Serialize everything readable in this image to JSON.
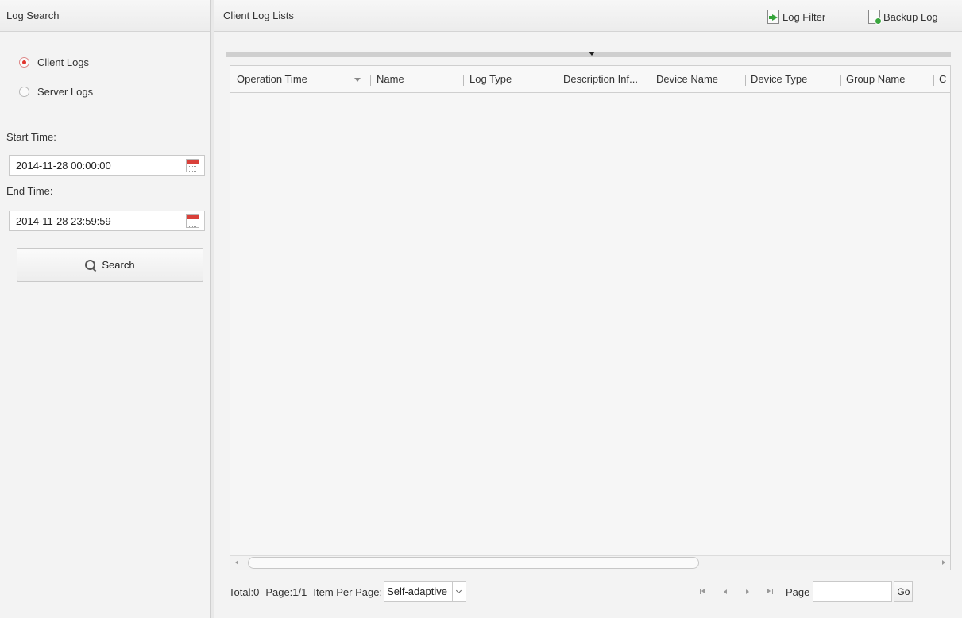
{
  "left": {
    "header_title": "Log Search",
    "radios": [
      {
        "label": "Client Logs",
        "checked": true
      },
      {
        "label": "Server Logs",
        "checked": false
      }
    ],
    "start_label": "Start Time:",
    "start_value": "2014-11-28 00:00:00",
    "end_label": "End Time:",
    "end_value": "2014-11-28 23:59:59",
    "search_label": "Search"
  },
  "right": {
    "title": "Client Log Lists",
    "log_filter_label": "Log Filter",
    "backup_log_label": "Backup Log",
    "columns": [
      "Operation Time",
      "Name",
      "Log Type",
      "Description Inf...",
      "Device Name",
      "Device Type",
      "Group Name",
      "C"
    ]
  },
  "pager": {
    "total": "Total:0",
    "page_info": "Page:1/1",
    "item_per_page_label": "Item Per Page:",
    "item_per_page_value": "Self-adaptive",
    "page_label": "Page",
    "page_input_value": "",
    "go_label": "Go"
  },
  "colors": {
    "radio_selected": "#e0342c",
    "calendar_icon": "#d9403a",
    "file_icon_accent": "#34a43a"
  }
}
